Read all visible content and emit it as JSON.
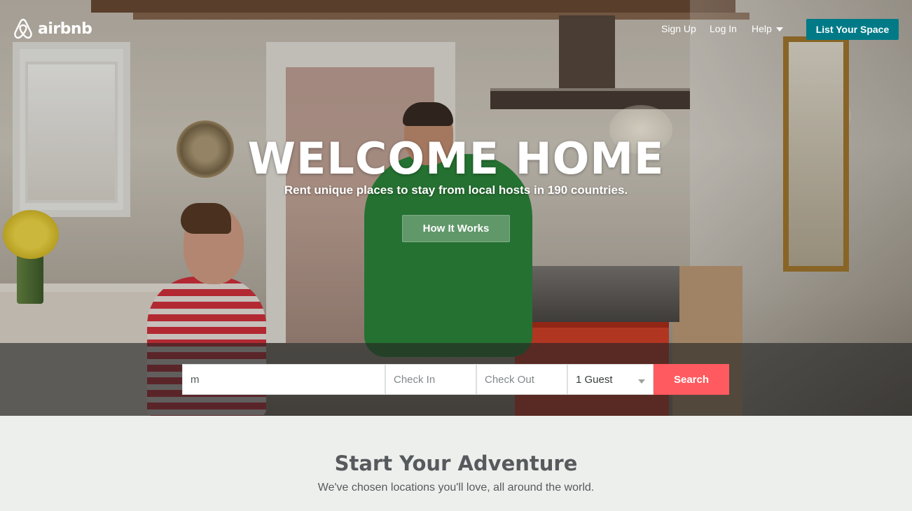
{
  "brand": {
    "name": "airbnb",
    "logo_icon": "airbnb-belo-icon",
    "accent": "#007a87",
    "primary": "#ff5a5f"
  },
  "nav": {
    "sign_up": "Sign Up",
    "log_in": "Log In",
    "help": "Help",
    "list_space": "List Your Space"
  },
  "hero": {
    "headline": "WELCOME HOME",
    "subhead": "Rent unique places to stay from local hosts in 190 countries.",
    "how_it_works": "How It Works"
  },
  "search": {
    "where_value": "m",
    "check_in_placeholder": "Check In",
    "check_out_placeholder": "Check Out",
    "guests_selected": "1 Guest",
    "button": "Search"
  },
  "adventure": {
    "title": "Start Your Adventure",
    "subtitle": "We've chosen locations you'll love, all around the world."
  }
}
